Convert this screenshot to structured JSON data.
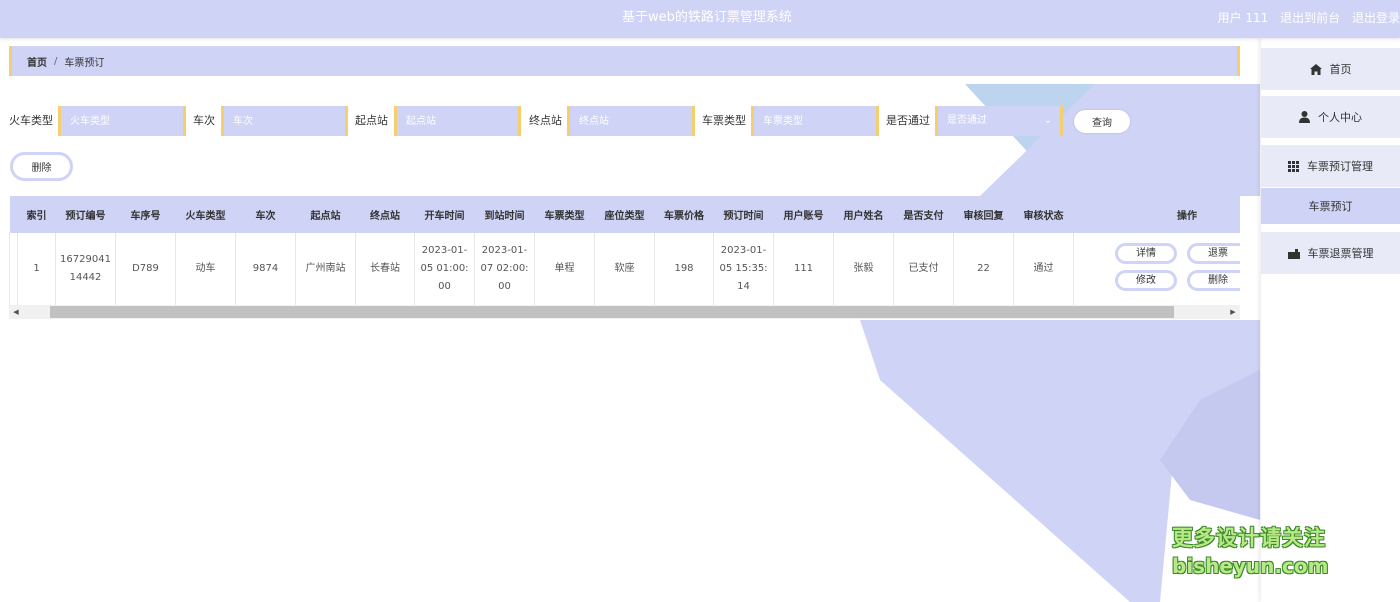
{
  "app": {
    "title": "基于web的铁路订票管理系统",
    "user_label": "用户 111",
    "front_link": "退出到前台",
    "logout_link": "退出登录"
  },
  "sidebar": {
    "home": "首页",
    "profile": "个人中心",
    "booking_mgmt": "车票预订管理",
    "booking_sub": "车票预订",
    "refund_mgmt": "车票退票管理"
  },
  "breadcrumb": {
    "home": "首页",
    "separator": "/",
    "current": "车票预订"
  },
  "search": {
    "train_type_label": "火车类型",
    "train_type_placeholder": "火车类型",
    "train_no_label": "车次",
    "train_no_placeholder": "车次",
    "from_label": "起点站",
    "from_placeholder": "起点站",
    "to_label": "终点站",
    "to_placeholder": "终点站",
    "ticket_type_label": "车票类型",
    "ticket_type_placeholder": "车票类型",
    "approved_label": "是否通过",
    "approved_placeholder": "是否通过",
    "query_button": "查询"
  },
  "delete_button": "删除",
  "table": {
    "headers": [
      "索引",
      "预订编号",
      "车序号",
      "火车类型",
      "车次",
      "起点站",
      "终点站",
      "开车时间",
      "到站时间",
      "车票类型",
      "座位类型",
      "车票价格",
      "预订时间",
      "用户账号",
      "用户姓名",
      "是否支付",
      "审核回复",
      "审核状态",
      "操作"
    ],
    "rows": [
      {
        "cells": [
          "1",
          "1672904114442",
          "D789",
          "动车",
          "9874",
          "广州南站",
          "长春站",
          "2023-01-05 01:00:00",
          "2023-01-07 02:00:00",
          "单程",
          "软座",
          "198",
          "2023-01-05 15:35:14",
          "111",
          "张毅",
          "已支付",
          "22",
          "通过"
        ],
        "actions": {
          "detail": "详情",
          "refund": "退票",
          "edit": "修改",
          "delete": "删除"
        }
      }
    ]
  },
  "watermark": {
    "line1": "更多设计请关注",
    "line2": "bisheyun.com"
  },
  "colors": {
    "primary": "#cfd3f5",
    "accent": "#f5cf6d",
    "deco_blue": "#bcd4ee"
  }
}
